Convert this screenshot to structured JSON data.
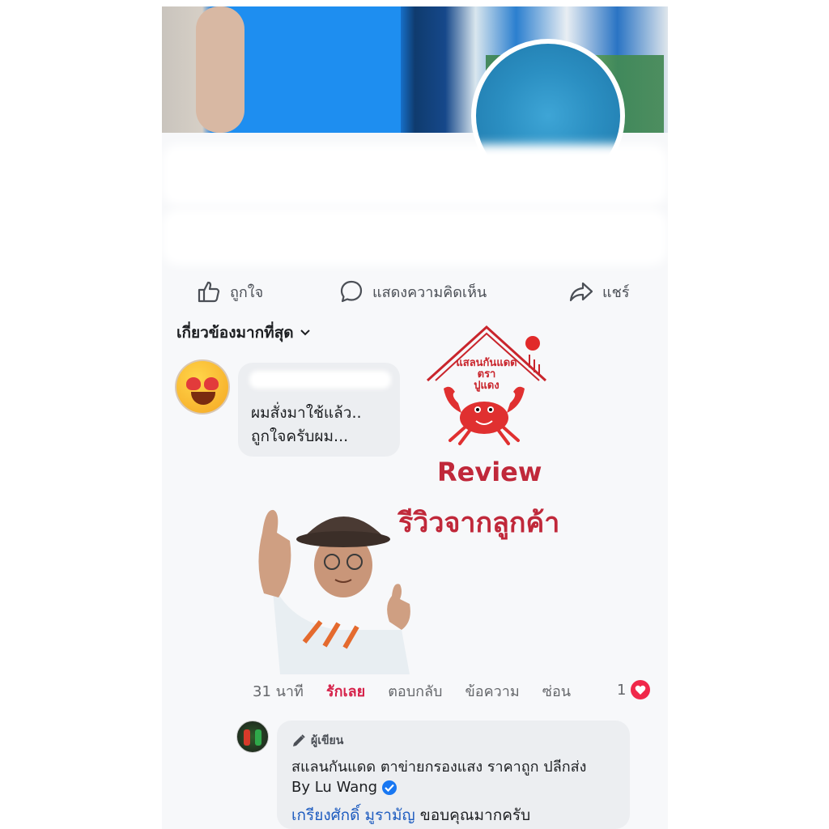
{
  "actions": {
    "like_label": "ถูกใจ",
    "comment_label": "แสดงความคิดเห็น",
    "share_label": "แชร์"
  },
  "sort": {
    "label": "เกี่ยวข้องมากที่สุด"
  },
  "comment": {
    "text": "ผมสั่งมาใช้แล้ว..\nถูกใจครับผม...",
    "time": "31 นาที",
    "love_label": "รักเลย",
    "reply_label": "ตอบกลับ",
    "message_label": "ข้อความ",
    "hide_label": "ซ่อน",
    "reaction_count": "1"
  },
  "logo": {
    "line1": "แสลนกันแดด",
    "line2": "ตรา",
    "line3": "ปูแดง",
    "review_en": "Review",
    "review_th": "รีวิวจากลูกค้า"
  },
  "reply": {
    "author_badge": "ผู้เขียน",
    "line1": "สแลนกันแดด ตาข่ายกรองแสง ราคาถูก ปลีกส่ง",
    "line2": "By Lu Wang",
    "mention": "เกรียงศักดิ์ มูรามัญ",
    "line3_rest": " ขอบคุณมากครับ"
  },
  "colors": {
    "accent_red": "#c0283a",
    "love_red": "#d6224a",
    "mention_blue": "#1d5bbf",
    "verified_blue": "#1877f2"
  }
}
